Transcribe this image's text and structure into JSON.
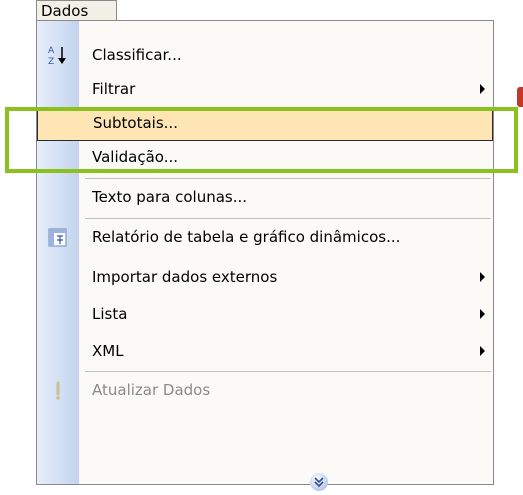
{
  "menu": {
    "title": "Dados",
    "items": [
      {
        "label": "Classificar...",
        "icon": "sort-az-icon"
      },
      {
        "label": "Filtrar",
        "submenu": true
      },
      {
        "label": "Subtotais...",
        "highlighted": true
      },
      {
        "label": "Validação..."
      },
      {
        "label": "Texto para colunas..."
      },
      {
        "label": "Relatório de tabela e gráfico dinâmicos...",
        "icon": "pivot-table-icon"
      },
      {
        "label": "Importar dados externos",
        "submenu": true
      },
      {
        "label": "Lista",
        "submenu": true
      },
      {
        "label": "XML",
        "submenu": true
      },
      {
        "label": "Atualizar Dados",
        "icon": "refresh-icon",
        "disabled": true
      }
    ],
    "expand_icon": "chevron-double-down-icon"
  },
  "colors": {
    "highlight": "#fde6b4",
    "annotation_box": "#8bc11e",
    "gutter": "#c3d3ee"
  }
}
